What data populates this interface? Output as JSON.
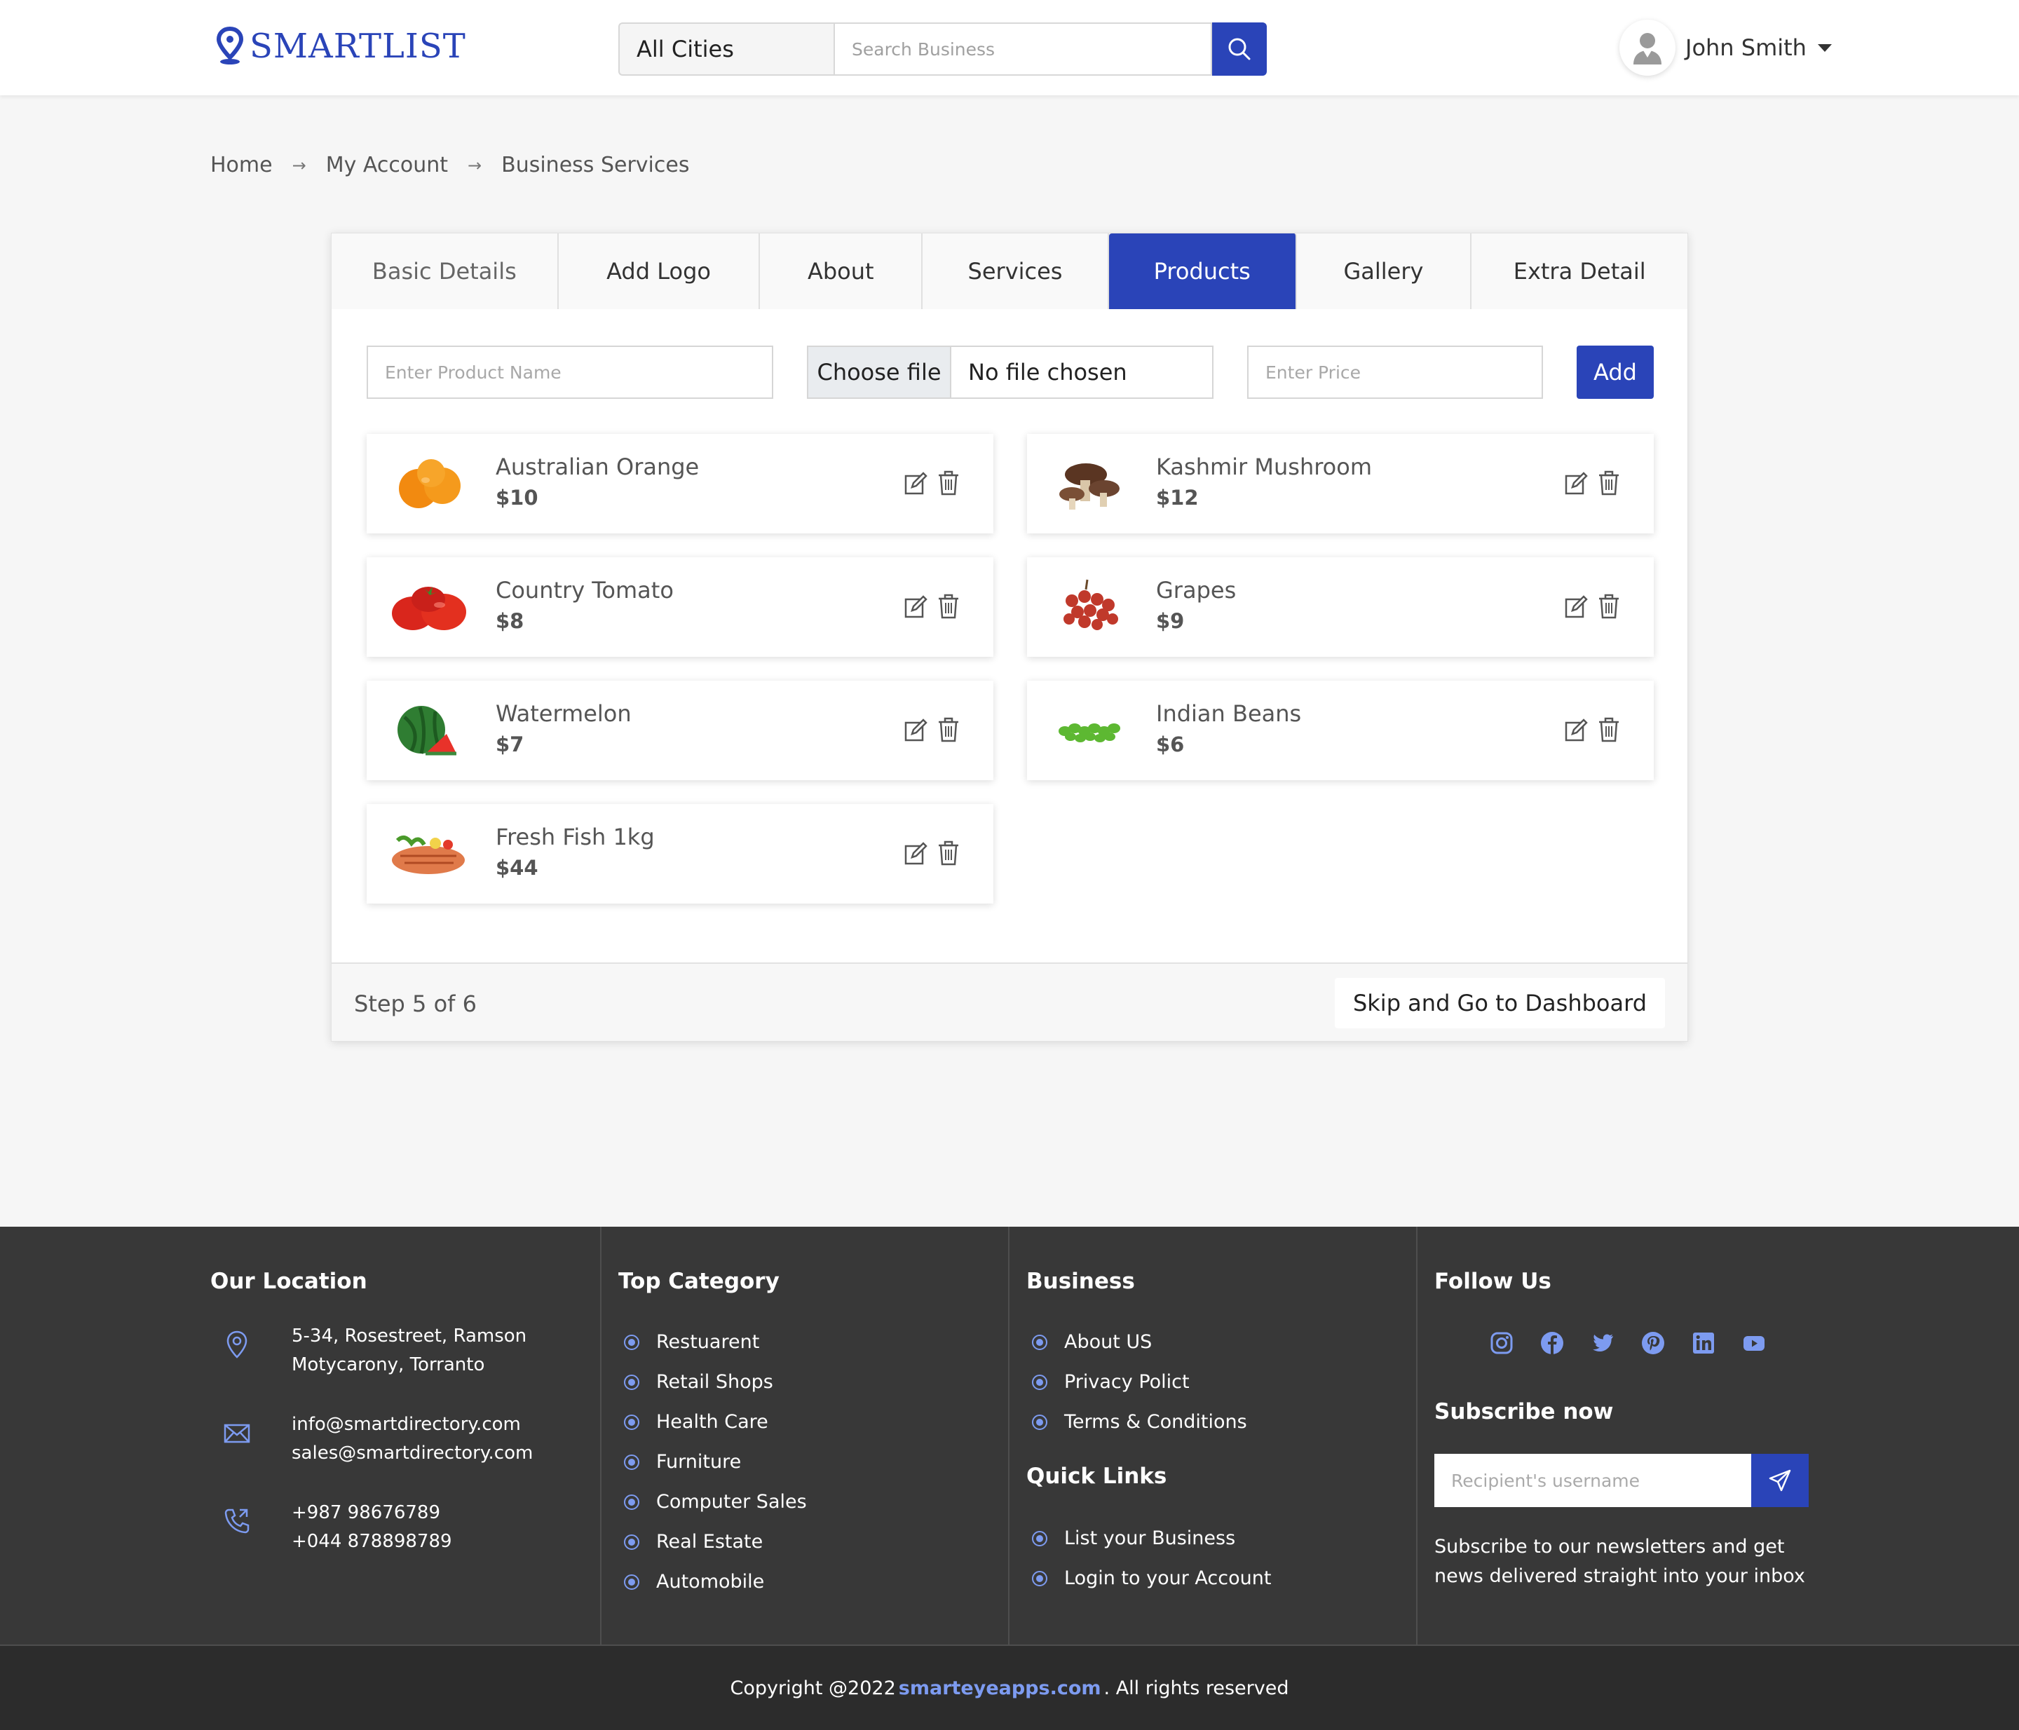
{
  "header": {
    "logo_text": "SMARTLIST",
    "city_select": "All Cities",
    "search_placeholder": "Search Business",
    "user_name": "John Smith"
  },
  "breadcrumb": [
    "Home",
    "My Account",
    "Business Services"
  ],
  "tabs": [
    {
      "label": "Basic Details",
      "state": "disabled"
    },
    {
      "label": "Add Logo",
      "state": "normal"
    },
    {
      "label": "About",
      "state": "normal"
    },
    {
      "label": "Services",
      "state": "normal"
    },
    {
      "label": "Products",
      "state": "active"
    },
    {
      "label": "Gallery",
      "state": "normal"
    },
    {
      "label": "Extra Detail",
      "state": "normal"
    }
  ],
  "form": {
    "product_name_placeholder": "Enter Product Name",
    "file_button": "Choose file",
    "file_status": "No file chosen",
    "price_placeholder": "Enter Price",
    "add_button": "Add"
  },
  "products": [
    {
      "name": "Australian Orange",
      "price": "$10",
      "image": "orange"
    },
    {
      "name": "Kashmir Mushroom",
      "price": "$12",
      "image": "mushroom"
    },
    {
      "name": "Country Tomato",
      "price": "$8",
      "image": "tomato"
    },
    {
      "name": "Grapes",
      "price": "$9",
      "image": "grapes"
    },
    {
      "name": "Watermelon",
      "price": "$7",
      "image": "watermelon"
    },
    {
      "name": "Indian Beans",
      "price": "$6",
      "image": "beans"
    },
    {
      "name": "Fresh Fish 1kg",
      "price": "$44",
      "image": "fish"
    }
  ],
  "card_footer": {
    "step_text": "Step 5 of 6",
    "skip_button": "Skip and Go to Dashboard"
  },
  "footer": {
    "location": {
      "heading": "Our Location",
      "address": [
        "5-34, Rosestreet, Ramson",
        "Motycarony, Torranto"
      ],
      "emails": [
        "info@smartdirectory.com",
        "sales@smartdirectory.com"
      ],
      "phones": [
        "+987 98676789",
        "+044 878898789"
      ]
    },
    "top_category": {
      "heading": "Top Category",
      "items": [
        "Restuarent",
        "Retail Shops",
        "Health Care",
        "Furniture",
        "Computer Sales",
        "Real Estate",
        "Automobile"
      ]
    },
    "business": {
      "heading": "Business",
      "items": [
        "About US",
        "Privacy Polict",
        "Terms & Conditions"
      ]
    },
    "quick_links": {
      "heading": "Quick Links",
      "items": [
        "List your Business",
        "Login to your Account"
      ]
    },
    "follow": {
      "heading": "Follow Us",
      "icons": [
        "instagram-icon",
        "facebook-icon",
        "twitter-icon",
        "pinterest-icon",
        "linkedin-icon",
        "youtube-icon"
      ]
    },
    "subscribe": {
      "heading": "Subscribe now",
      "placeholder": "Recipient's username",
      "note": "Subscribe to our newsletters and get news delivered straight into your inbox"
    }
  },
  "copyright": {
    "prefix": "Copyright @2022",
    "link": "smarteyeapps.com",
    "suffix": ". All rights reserved"
  },
  "colors": {
    "brand": "#2a44b8",
    "footer_bg": "#383838",
    "accent_light": "#7d9bf0"
  }
}
